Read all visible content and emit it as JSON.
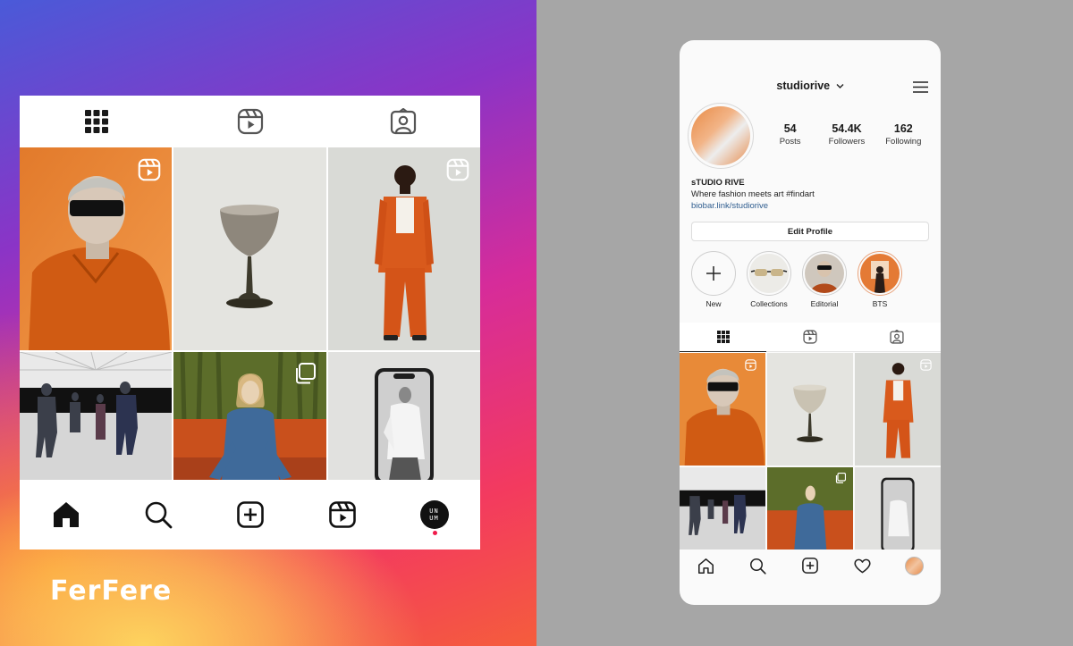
{
  "brand": {
    "logo_text": "FerFere"
  },
  "left_card": {
    "tabs": [
      {
        "icon": "grid-icon",
        "active": true
      },
      {
        "icon": "reels-icon",
        "active": false
      },
      {
        "icon": "tagged-icon",
        "active": false
      }
    ],
    "posts": [
      {
        "subject": "model with sunglasses in orange shirt",
        "badge": "reel-icon"
      },
      {
        "subject": "coupe glass on grey background",
        "badge": ""
      },
      {
        "subject": "model in orange suit",
        "badge": "reel-icon"
      },
      {
        "subject": "people in exhibition hall",
        "badge": ""
      },
      {
        "subject": "woman in denim on orange sofa",
        "badge": "carousel-icon"
      },
      {
        "subject": "phone showing fashion photo",
        "badge": ""
      }
    ],
    "nav": [
      {
        "icon": "home-icon"
      },
      {
        "icon": "search-icon"
      },
      {
        "icon": "add-post-icon"
      },
      {
        "icon": "reels-icon"
      },
      {
        "icon": "profile-avatar",
        "avatar_text": "UN UM"
      }
    ],
    "colors": {
      "active_dot": "#ef1a4a"
    }
  },
  "phone": {
    "header": {
      "username": "studiorive"
    },
    "stats": [
      {
        "value": "54",
        "label": "Posts"
      },
      {
        "value": "54.4K",
        "label": "Followers"
      },
      {
        "value": "162",
        "label": "Following"
      }
    ],
    "bio": {
      "name": "sTUDIO RIVE",
      "tagline": "Where fashion meets art #findart",
      "link": "biobar.link/studiorive"
    },
    "edit_profile_label": "Edit Profile",
    "highlights": [
      {
        "label": "New",
        "icon": "plus-icon"
      },
      {
        "label": "Collections",
        "icon": "collections-thumb"
      },
      {
        "label": "Editorial",
        "icon": "editorial-thumb"
      },
      {
        "label": "BTS",
        "icon": "bts-thumb"
      }
    ],
    "tabs": [
      {
        "icon": "grid-icon",
        "active": true
      },
      {
        "icon": "reels-icon",
        "active": false
      },
      {
        "icon": "tagged-icon",
        "active": false
      }
    ],
    "nav": [
      {
        "icon": "home-icon"
      },
      {
        "icon": "search-icon"
      },
      {
        "icon": "add-post-icon"
      },
      {
        "icon": "heart-icon"
      },
      {
        "icon": "profile-avatar"
      }
    ]
  }
}
